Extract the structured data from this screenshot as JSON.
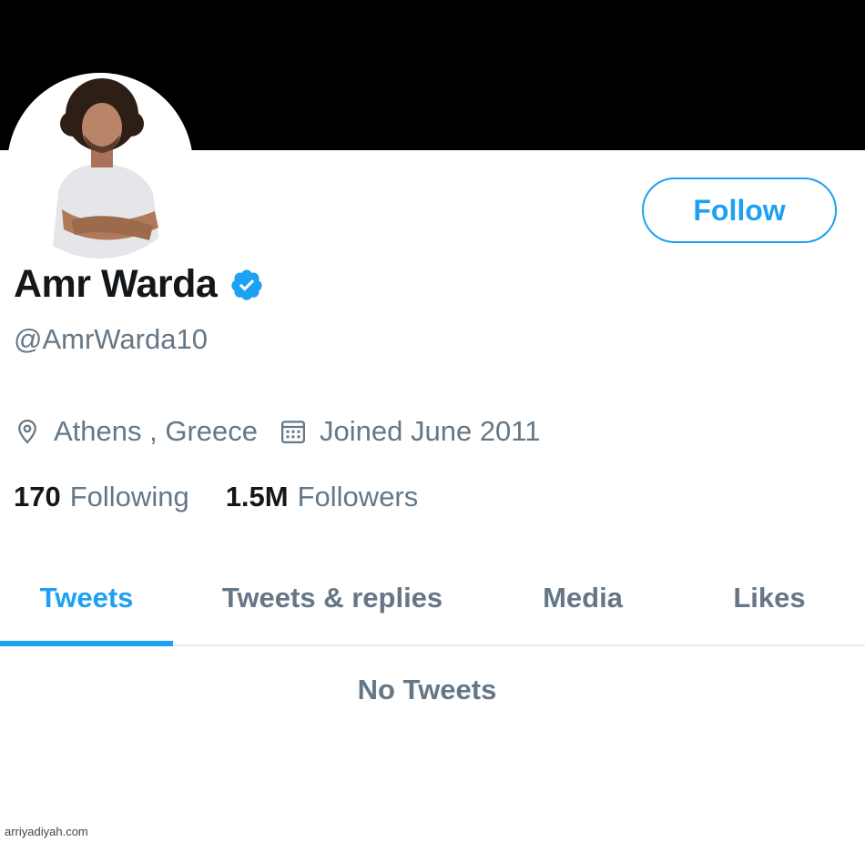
{
  "profile": {
    "display_name": "Amr Warda",
    "handle": "@AmrWarda10",
    "location": "Athens , Greece",
    "joined": "Joined June 2011",
    "following_count": "170",
    "following_label": "Following",
    "followers_count": "1.5M",
    "followers_label": "Followers",
    "verified": true
  },
  "actions": {
    "follow_label": "Follow"
  },
  "tabs": [
    {
      "label": "Tweets",
      "active": true
    },
    {
      "label": "Tweets & replies",
      "active": false
    },
    {
      "label": "Media",
      "active": false
    },
    {
      "label": "Likes",
      "active": false
    }
  ],
  "timeline": {
    "empty_message": "No Tweets"
  },
  "watermark": "arriyadiyah.com",
  "icons": {
    "location": "location-pin-icon",
    "joined": "calendar-icon",
    "verified": "verified-badge-icon"
  },
  "colors": {
    "accent": "#1da1f2",
    "text_primary": "#14171a",
    "text_secondary": "#657786",
    "banner": "#000000",
    "divider": "#e6ecf0"
  }
}
